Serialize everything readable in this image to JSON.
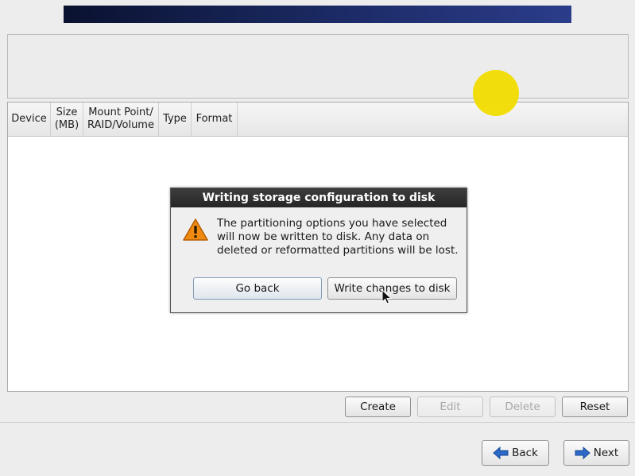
{
  "table": {
    "headers": [
      {
        "label": "Device"
      },
      {
        "label": "Size\n(MB)"
      },
      {
        "label": "Mount Point/\nRAID/Volume"
      },
      {
        "label": "Type"
      },
      {
        "label": "Format"
      }
    ]
  },
  "actions": {
    "create": "Create",
    "edit": "Edit",
    "delete": "Delete",
    "reset": "Reset"
  },
  "nav": {
    "back": "Back",
    "next": "Next"
  },
  "dialog": {
    "title": "Writing storage configuration to disk",
    "message": "The partitioning options you have selected will now be written to disk.  Any data on deleted or reformatted partitions will be lost.",
    "go_back": "Go back",
    "write": "Write changes to disk"
  },
  "colors": {
    "banner": "#1c2b66",
    "highlight": "#f2dc00",
    "warning": "#f08a10",
    "nav_arrow": "#2c69c9"
  }
}
